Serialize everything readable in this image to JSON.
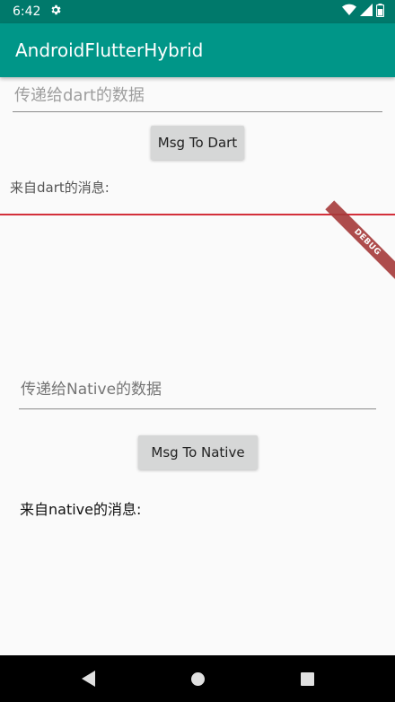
{
  "status_bar": {
    "time": "6:42",
    "icons": [
      "gear-icon",
      "wifi-icon",
      "signal-icon",
      "battery-icon"
    ]
  },
  "app_bar": {
    "title": "AndroidFlutterHybrid"
  },
  "native_section": {
    "input_placeholder": "传递给dart的数据",
    "input_value": "",
    "button_label": "Msg To Dart",
    "message_label": "来自dart的消息:"
  },
  "flutter_section": {
    "debug_banner": "DEBUG",
    "input_placeholder": "传递给Native的数据",
    "input_value": "",
    "button_label": "Msg To Native",
    "message_label": "来自native的消息:"
  },
  "nav_bar": {
    "buttons": [
      "back-icon",
      "home-icon",
      "recents-icon"
    ]
  },
  "colors": {
    "status_bar": "#00796b",
    "app_bar": "#009688",
    "divider": "#d32f3a",
    "button": "#d6d7d7",
    "background": "#fafafa"
  }
}
